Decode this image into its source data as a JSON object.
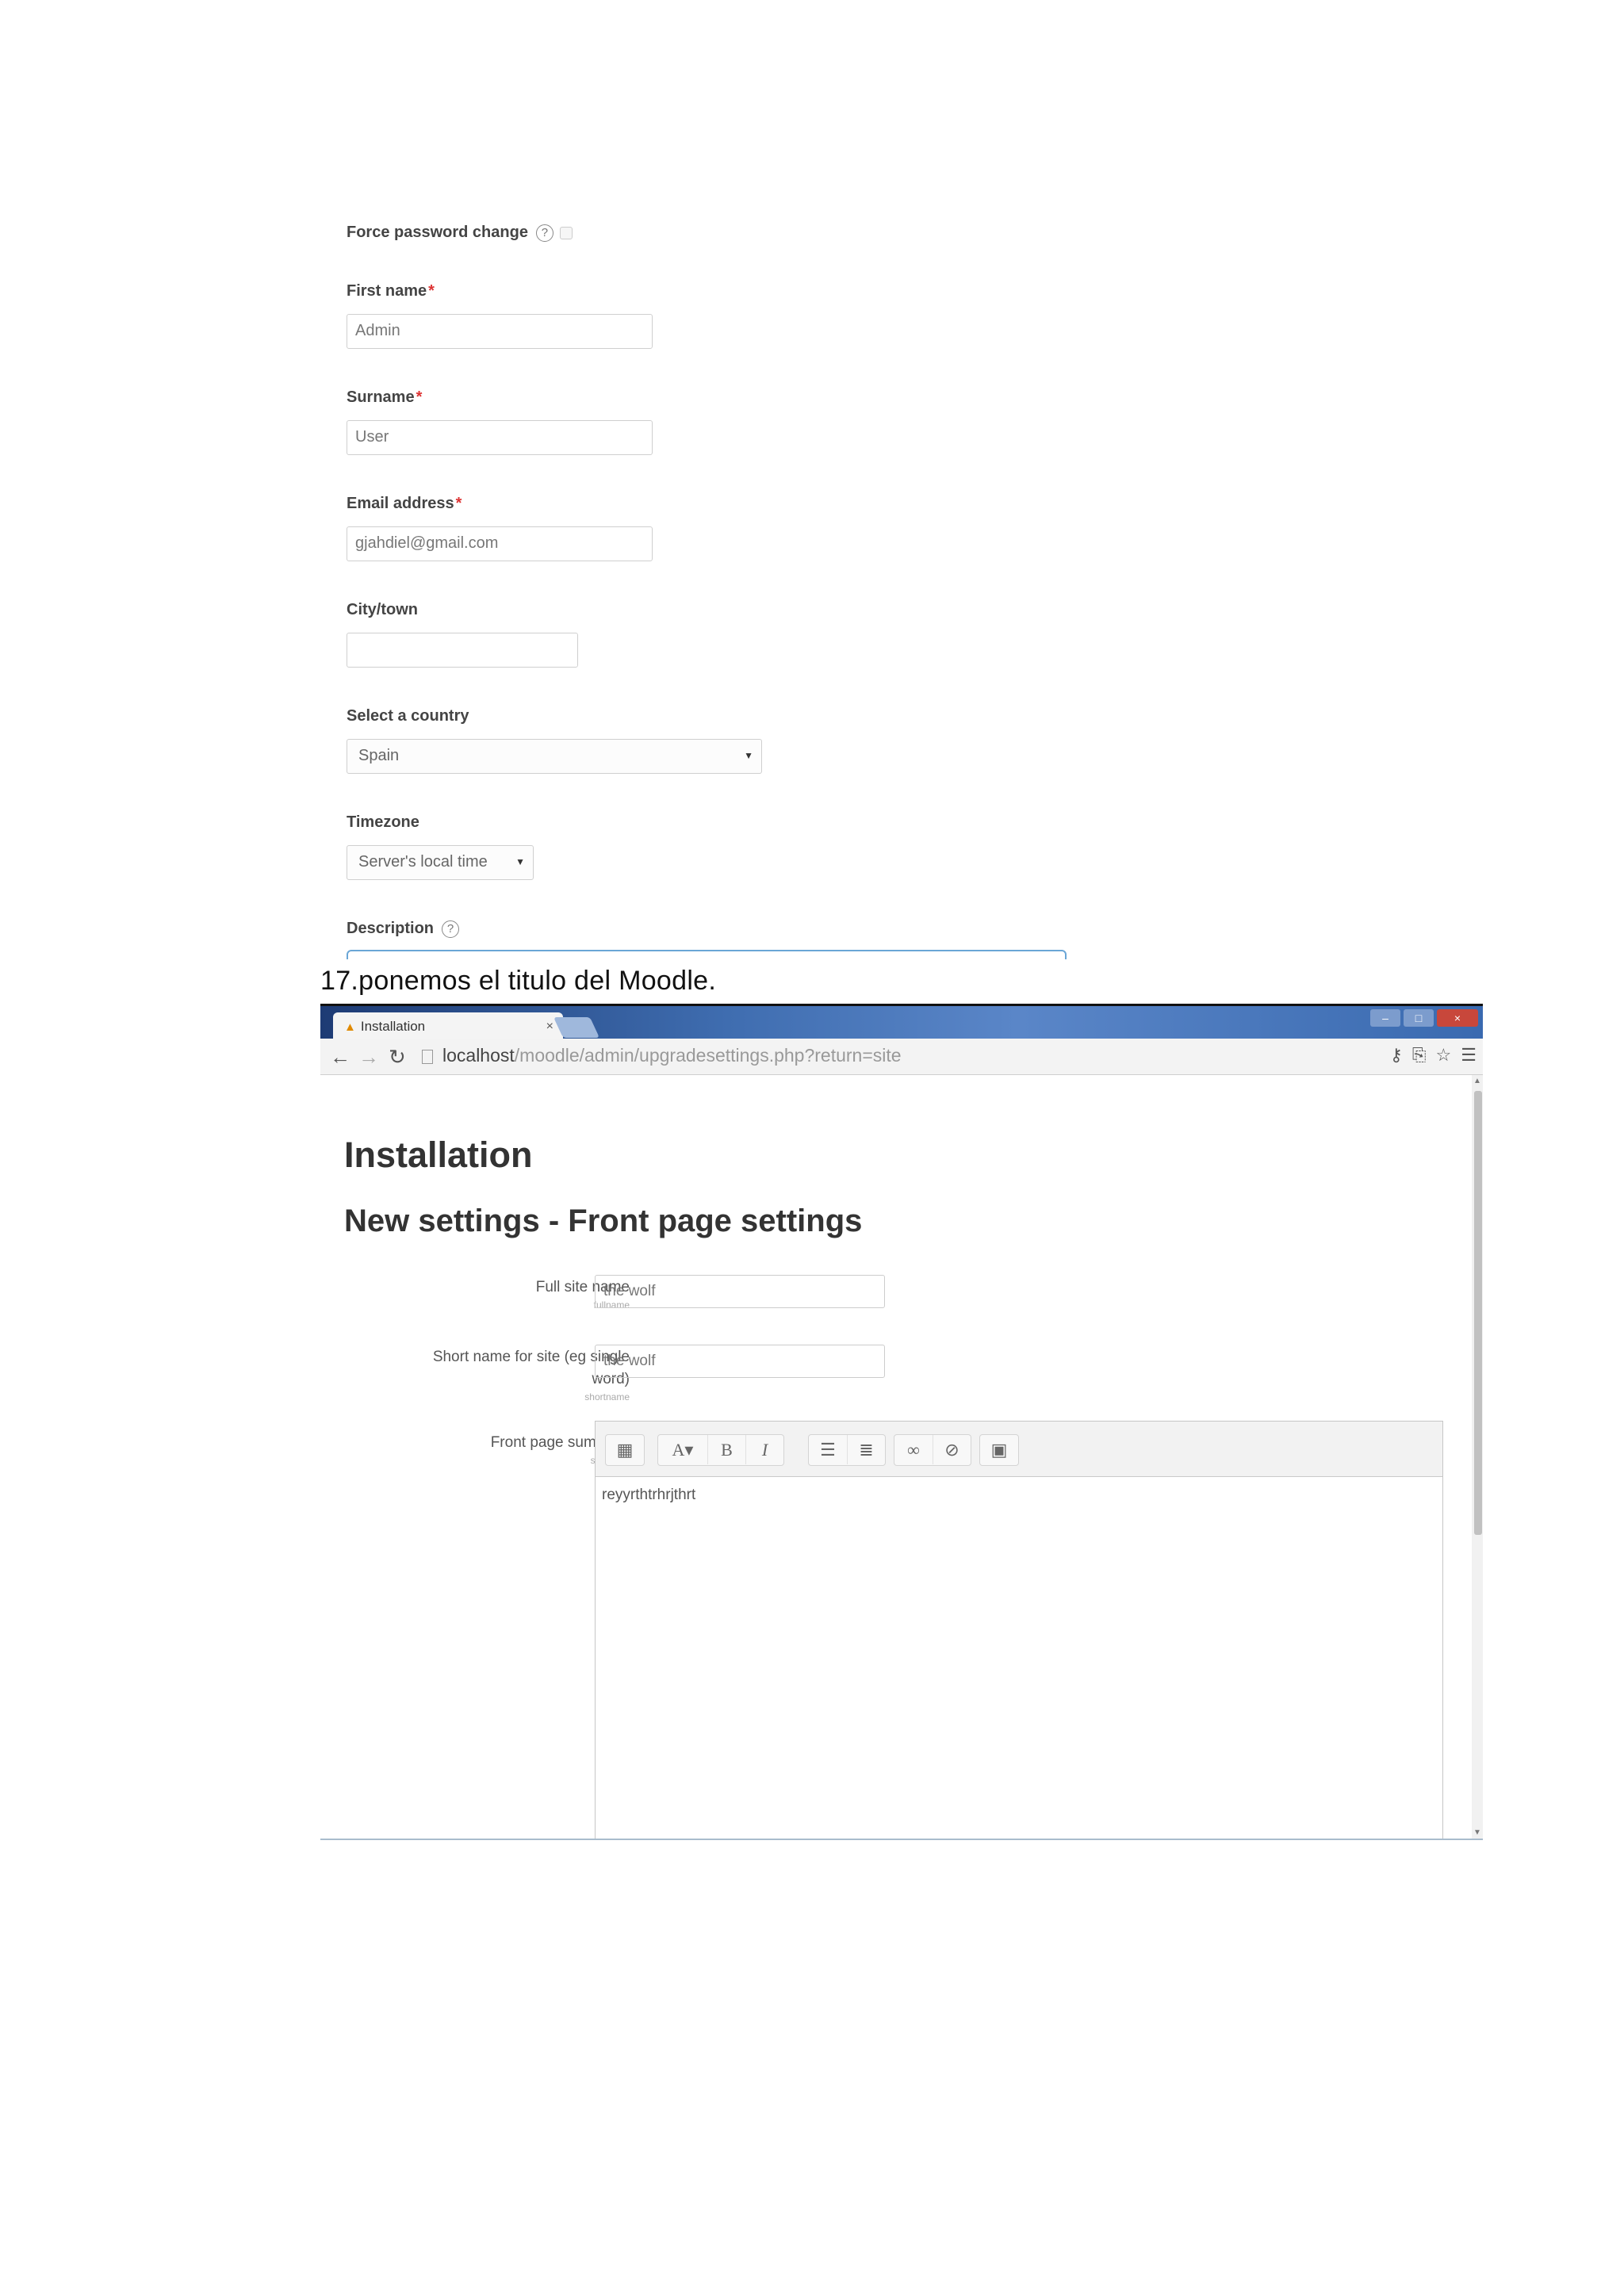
{
  "profile_form": {
    "force_password_label": "Force password change",
    "first_name_label": "First name",
    "first_name_value": "Admin",
    "surname_label": "Surname",
    "surname_value": "User",
    "email_label": "Email address",
    "email_value": "gjahdiel@gmail.com",
    "city_label": "City/town",
    "city_value": "",
    "country_label": "Select a country",
    "country_value": "Spain",
    "timezone_label": "Timezone",
    "timezone_value": "Server's local time",
    "description_label": "Description",
    "required_mark": "*",
    "help_glyph": "?"
  },
  "caption": "17.ponemos el titulo del Moodle.",
  "browser": {
    "tab_title": "Installation",
    "tab_close": "×",
    "url_host": "localhost",
    "url_path": "/moodle/admin/upgradesettings.php?return=site",
    "window_controls": [
      "–",
      "□",
      "×"
    ]
  },
  "page": {
    "heading": "Installation",
    "subheading": "New settings - Front page settings",
    "fullname_label": "Full site name",
    "fullname_sub": "fullname",
    "fullname_value": "the wolf",
    "shortname_label": "Short name for site (eg single word)",
    "shortname_sub": "shortname",
    "shortname_value": "the wolf",
    "summary_label": "Front page summary",
    "summary_sub": "summary",
    "summary_text": "reyyrthtrhrjthrt"
  },
  "colors": {
    "required": "#dd3333",
    "editor_border": "#6aa6d6",
    "titlebar": "#3f6db0"
  },
  "icons": [
    "help-icon",
    "back-icon",
    "forward-icon",
    "reload-icon",
    "page-icon",
    "key-icon",
    "translate-icon",
    "star-icon",
    "menu-icon",
    "bold-icon",
    "italic-icon",
    "bullet-list-icon",
    "numbered-list-icon",
    "link-icon",
    "unlink-icon",
    "image-icon"
  ]
}
